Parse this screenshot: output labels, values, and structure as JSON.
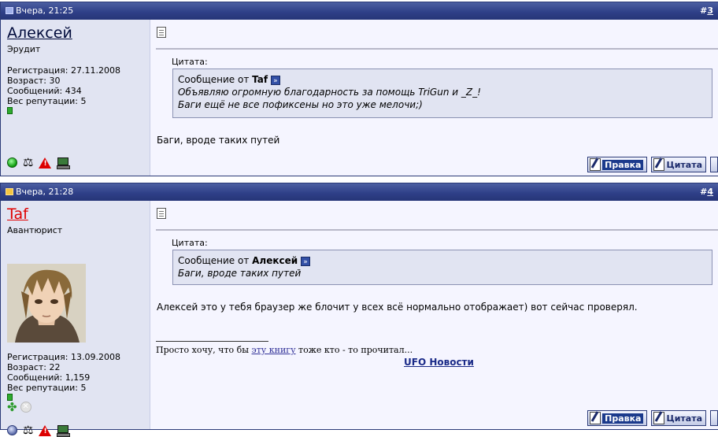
{
  "posts": [
    {
      "date": "Вчера, 21:25",
      "number_prefix": "#",
      "number": "3",
      "author": {
        "name": "Алексей",
        "title": "Эрудит",
        "registration": "Регистрация: 27.11.2008",
        "age": "Возраст: 30",
        "messages": "Сообщений: 434",
        "reputation": "Вес репутации: 5",
        "status": "online"
      },
      "quote": {
        "label": "Цитата:",
        "from_prefix": "Сообщение от ",
        "from": "Taf",
        "line1": "Объявляю огромную благодарность за помощь TriGun и _Z_!",
        "line2": "Баги ещё не все пофиксены но это уже мелочи;)"
      },
      "message": "Баги, вроде таких путей",
      "buttons": {
        "edit": "Правка",
        "quote": "Цитата"
      }
    },
    {
      "date": "Вчера, 21:28",
      "number_prefix": "#",
      "number": "4",
      "author": {
        "name": "Taf",
        "title": "Авантюрист",
        "registration": "Регистрация: 13.09.2008",
        "age": "Возраст: 22",
        "messages": "Сообщений: 1,159",
        "reputation": "Вес репутации: 5",
        "status": "offline"
      },
      "quote": {
        "label": "Цитата:",
        "from_prefix": "Сообщение от ",
        "from": "Алексей",
        "line1": "Баги, вроде таких путей"
      },
      "message": "Алексей это у тебя браузер же блочит у всех всё нормально отображает) вот сейчас проверял.",
      "signature": {
        "before": "Просто хочу, что бы ",
        "link": "эту книгу",
        "after": " тоже кто - то прочитал...",
        "ufo_link": "UFO Новости"
      },
      "buttons": {
        "edit": "Правка",
        "quote": "Цитата"
      }
    }
  ],
  "colors": {
    "header_bg": "#2f4088",
    "sidebar_bg": "#e1e4f2",
    "quote_bg": "#e1e4f2",
    "name_red": "#e00000"
  }
}
